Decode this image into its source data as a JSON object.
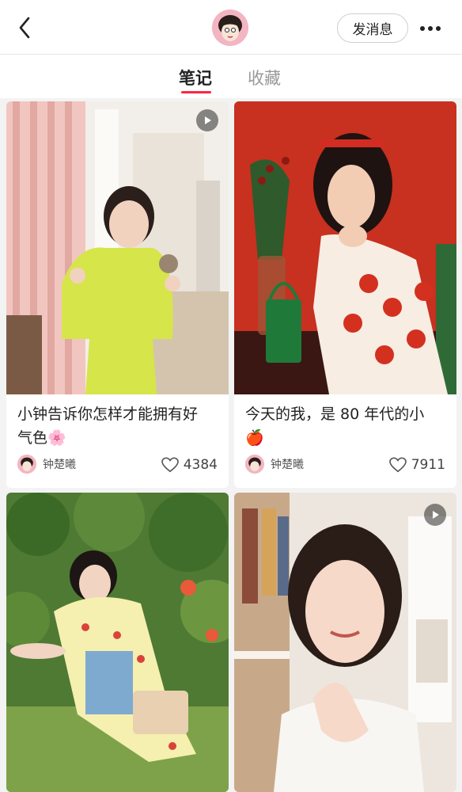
{
  "header": {
    "back_icon": "chevron-left-icon",
    "message_button": "发消息",
    "more_icon": "more-dots-icon"
  },
  "tabs": [
    {
      "label": "笔记",
      "active": true
    },
    {
      "label": "收藏",
      "active": false
    }
  ],
  "accent_color": "#ff2442",
  "notes": [
    {
      "title_line1": "小钟告诉你怎样才能拥有好",
      "title_line2": "气色",
      "emoji": "🌸",
      "author": "钟楚曦",
      "likes": "4384",
      "is_video": true
    },
    {
      "title_line1": "今天的我，是 80 年代的小",
      "title_line2": "",
      "emoji": "🍎",
      "author": "钟楚曦",
      "likes": "7911",
      "is_video": false
    },
    {
      "is_video": false
    },
    {
      "is_video": true
    }
  ]
}
